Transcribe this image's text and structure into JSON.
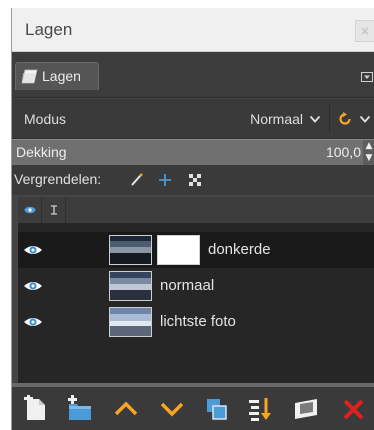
{
  "window": {
    "title": "Lagen",
    "close_symbol": "×"
  },
  "tab": {
    "label": "Lagen",
    "icon": "layers-icon"
  },
  "mode": {
    "label": "Modus",
    "value": "Normaal"
  },
  "opacity": {
    "label": "Dekking",
    "value": "100,0"
  },
  "lock": {
    "label": "Vergrendelen:",
    "icons": [
      "lock-pixels-icon",
      "lock-position-icon",
      "lock-alpha-icon"
    ]
  },
  "layers": [
    {
      "name": "donkerde",
      "visible": true,
      "selected": true,
      "has_mask": true
    },
    {
      "name": "normaal",
      "visible": true,
      "selected": false,
      "has_mask": false
    },
    {
      "name": "lichtste foto",
      "visible": true,
      "selected": false,
      "has_mask": false
    }
  ],
  "toolbar": [
    "new-layer-icon",
    "new-layer-group-icon",
    "raise-layer-icon",
    "lower-layer-icon",
    "duplicate-layer-icon",
    "merge-down-icon",
    "add-mask-icon",
    "delete-layer-icon"
  ],
  "colors": {
    "accent_orange": "#f5a623",
    "accent_blue": "#4a9bd8",
    "delete_red": "#e02020"
  }
}
